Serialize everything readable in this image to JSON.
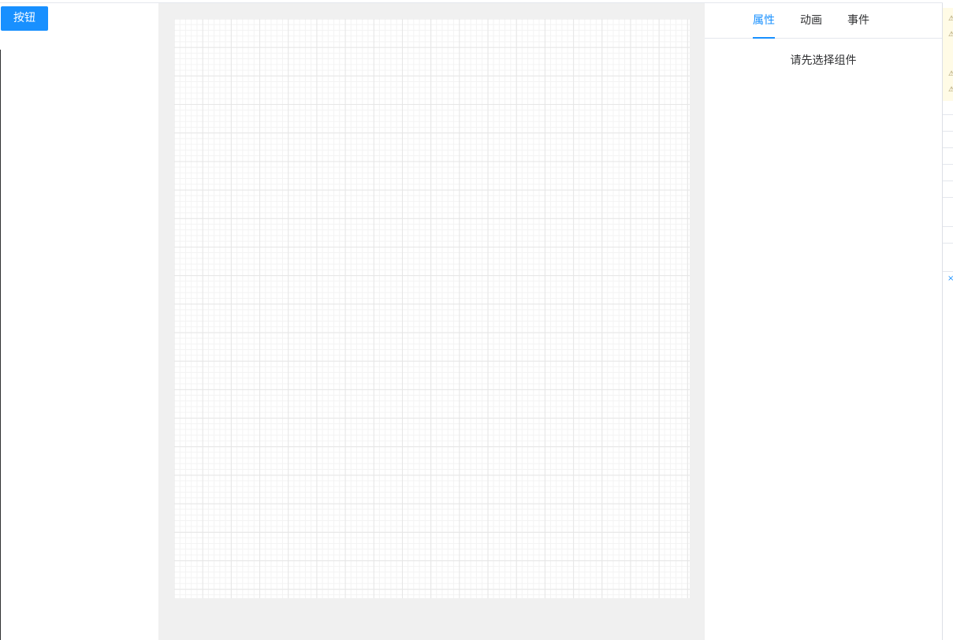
{
  "left_panel": {
    "components": [
      {
        "label": "按钮"
      }
    ]
  },
  "right_panel": {
    "tabs": [
      {
        "label": "属性",
        "active": true
      },
      {
        "label": "动画",
        "active": false
      },
      {
        "label": "事件",
        "active": false
      }
    ],
    "empty_hint": "请先选择组件"
  },
  "colors": {
    "accent": "#1890ff",
    "editor_background": "#f0f0f0",
    "canvas_background": "#ffffff"
  },
  "icons": {
    "sliver_warning_icons": [
      "warning-icon",
      "warning-icon",
      "warning-icon",
      "warning-icon"
    ],
    "sliver_close_icon": "close-icon"
  }
}
